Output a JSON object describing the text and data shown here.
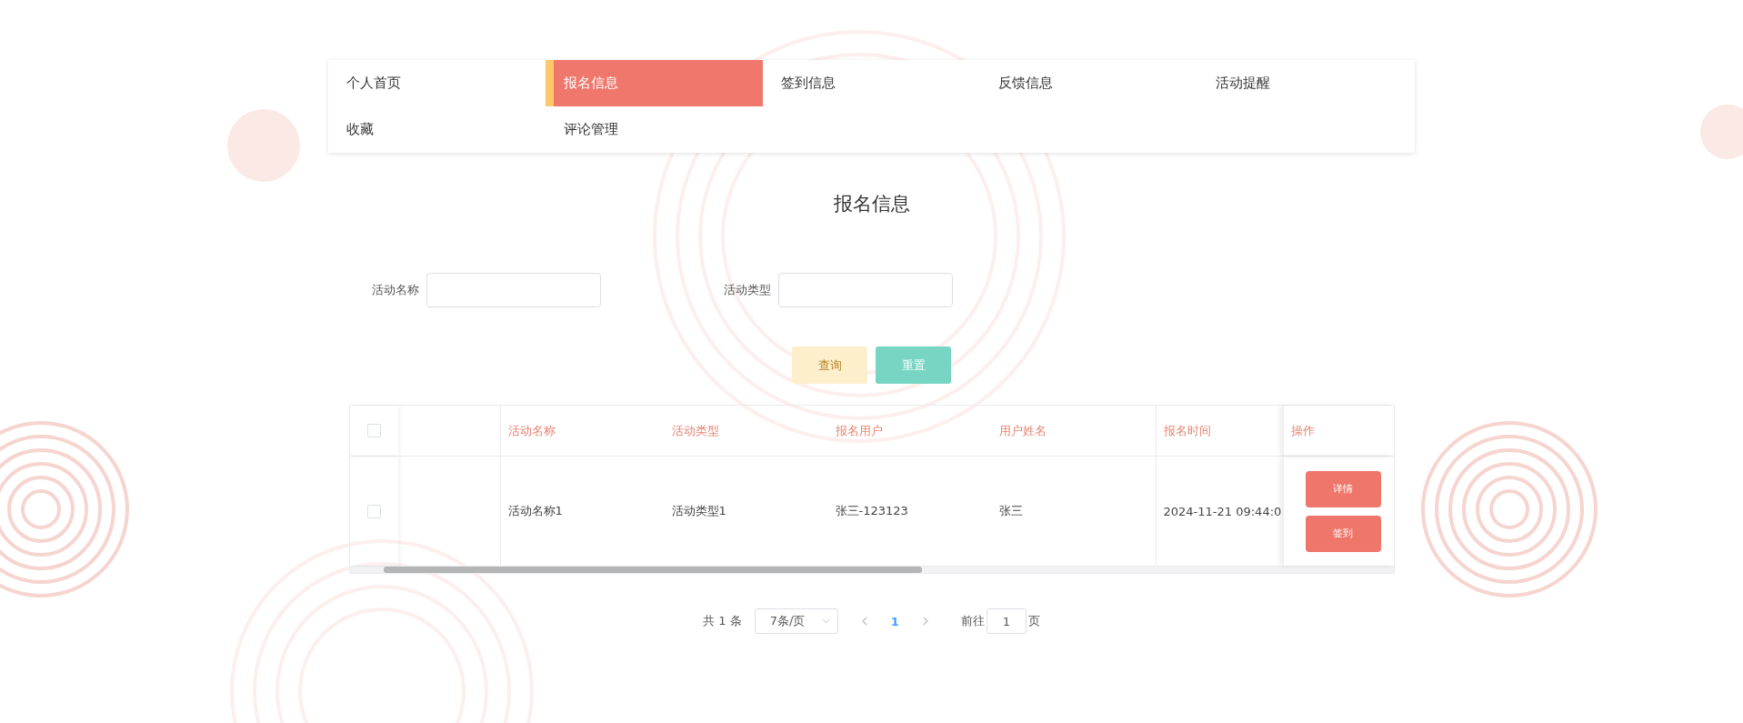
{
  "nav": {
    "items": [
      {
        "label": "个人首页",
        "selected": false
      },
      {
        "label": "报名信息",
        "selected": true
      },
      {
        "label": "签到信息",
        "selected": false
      },
      {
        "label": "反馈信息",
        "selected": false
      },
      {
        "label": "活动提醒",
        "selected": false
      },
      {
        "label": "收藏",
        "selected": false
      },
      {
        "label": "评论管理",
        "selected": false
      }
    ]
  },
  "page_title": "报名信息",
  "search": {
    "fields": [
      {
        "label": "活动名称"
      },
      {
        "label": "活动类型"
      }
    ],
    "buttons": [
      {
        "label": "查询",
        "kind": "query"
      },
      {
        "label": "重置",
        "kind": "reset"
      }
    ]
  },
  "table": {
    "select_all": {
      "checked": false
    },
    "columns": [
      "活动名称",
      "活动类型",
      "报名用户",
      "用户姓名",
      "报名时间"
    ],
    "action_column": "操作",
    "rows": [
      {
        "checked": false,
        "cells": [
          "活动名称1",
          "活动类型1",
          "张三-123123",
          "张三",
          "2024-11-21 09:44:0"
        ],
        "actions": [
          "详情",
          "签到"
        ]
      }
    ]
  },
  "pagination": {
    "total": "共 1 条",
    "page_size": "7条/页",
    "pages": [
      {
        "label": "1",
        "selected": true
      }
    ],
    "goto_label": "前往",
    "goto_value": "1",
    "goto_suffix": "页"
  }
}
